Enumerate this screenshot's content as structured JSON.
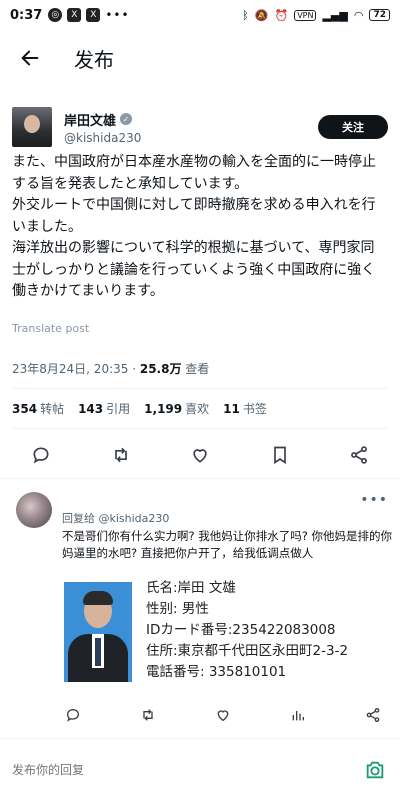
{
  "status_bar": {
    "time": "0:37",
    "vpn": "VPN",
    "battery": "72"
  },
  "header": {
    "title": "发布"
  },
  "author": {
    "name": "岸田文雄",
    "handle": "@kishida230",
    "follow_label": "关注"
  },
  "post": {
    "text": "また、中国政府が日本産水産物の輸入を全面的に一時停止する旨を発表したと承知しています。\n外交ルートで中国側に対して即時撤廃を求める申入れを行いました。\n海洋放出の影響について科学的根拠に基づいて、専門家同士がしっかりと議論を行っていくよう強く中国政府に強く働きかけてまいります。",
    "translate": "Translate post",
    "date": "23年8月24日, 20:35 · ",
    "views": "25.8万",
    "views_label": " 查看"
  },
  "stats": {
    "reposts": "354",
    "reposts_label": "转帖",
    "quotes": "143",
    "quotes_label": "引用",
    "likes": "1,199",
    "likes_label": "喜欢",
    "bookmarks": "11",
    "bookmarks_label": "书签"
  },
  "reply": {
    "reply_to": "回复给 @kishida230",
    "text": "不是哥们你有什么实力啊? 我他妈让你排水了吗? 你他妈是排的你妈逼里的水吧? 直接把你户开了，给我低调点做人",
    "id_card": {
      "name": "氏名:岸田 文雄",
      "gender": "性别: 男性",
      "id": "IDカード番号:235422083008",
      "address": "住所:東京都千代田区永田町2-3-2",
      "phone": "電話番号: 335810101"
    }
  },
  "compose": {
    "placeholder": "发布你的回复"
  },
  "icons": {
    "back": "arrow-left-icon",
    "reply": "comment-icon",
    "repost": "repost-icon",
    "like": "heart-icon",
    "bookmark": "bookmark-icon",
    "share": "share-icon",
    "camera": "camera-icon"
  },
  "colors": {
    "accent_green": "#1d9b6f",
    "text": "#0f1419",
    "muted": "#536471"
  }
}
